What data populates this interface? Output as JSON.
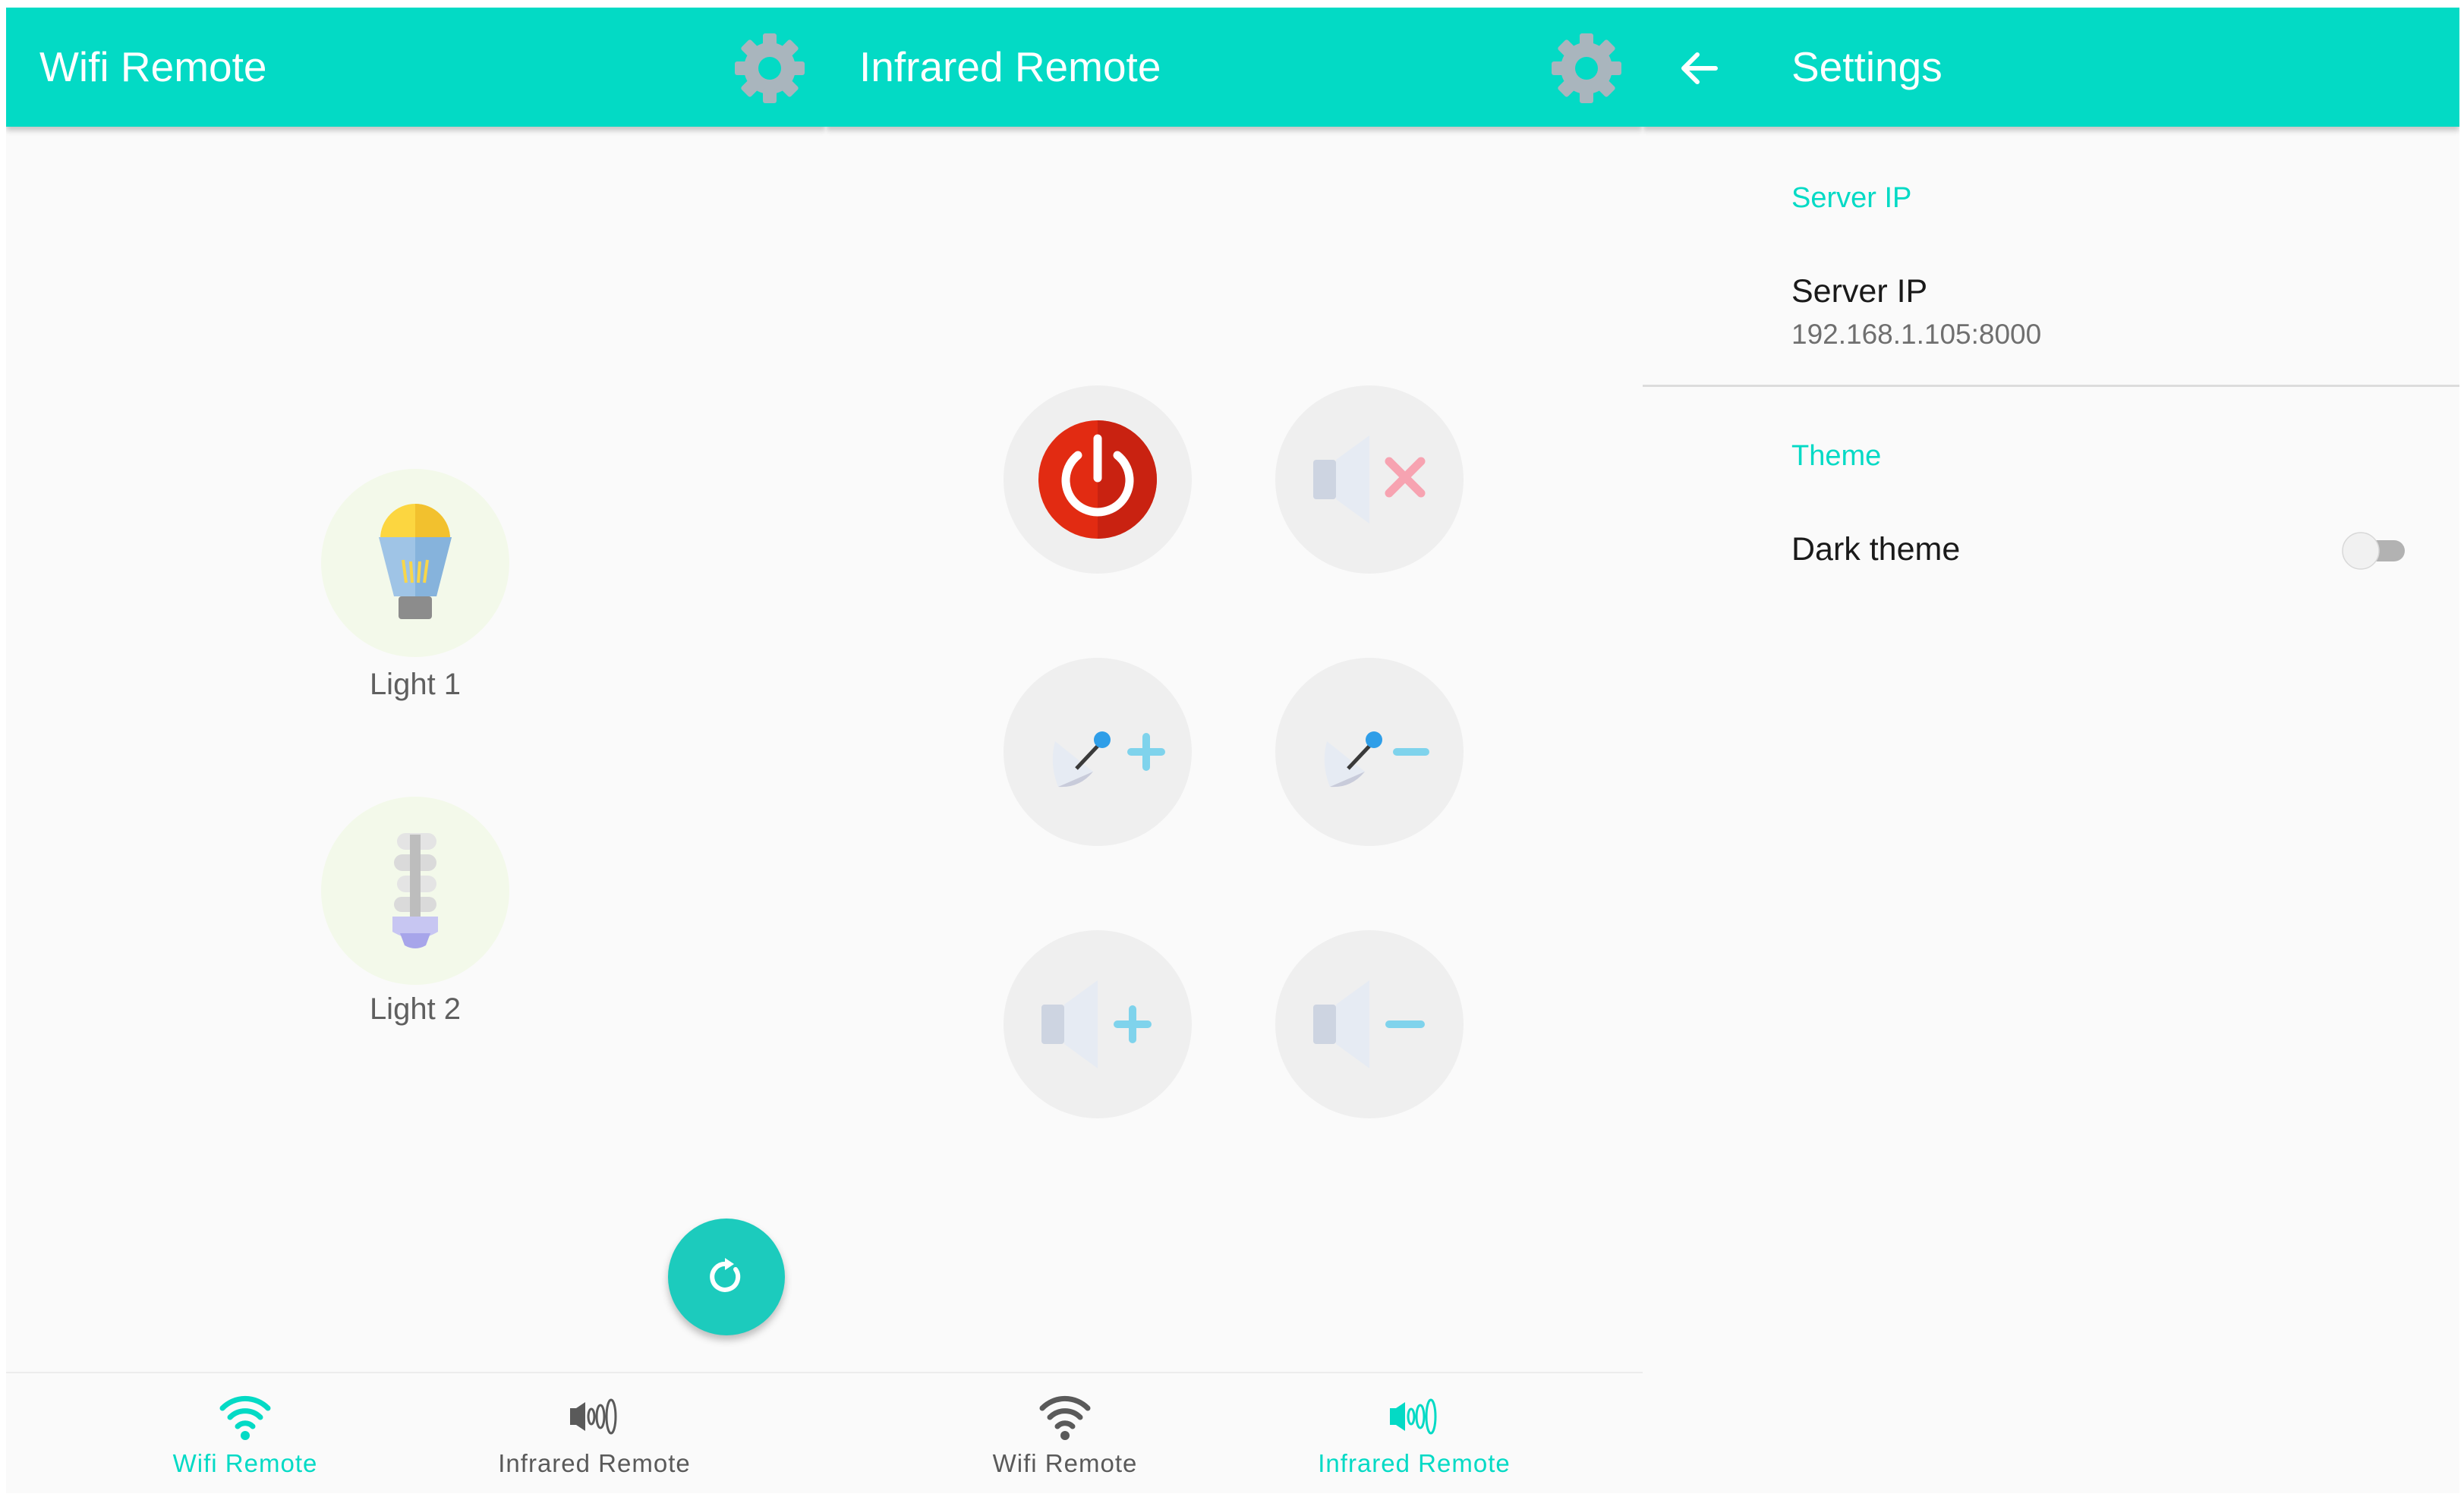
{
  "wifi_screen": {
    "title": "Wifi Remote",
    "settings_icon": "gear-icon",
    "lights": [
      {
        "label": "Light 1",
        "icon": "bulb-on-icon"
      },
      {
        "label": "Light 2",
        "icon": "bulb-off-icon"
      }
    ],
    "refresh_icon": "refresh-icon"
  },
  "infrared_screen": {
    "title": "Infrared Remote",
    "settings_icon": "gear-icon",
    "buttons": [
      "power-icon",
      "mute-icon",
      "channel-up-icon",
      "channel-down-icon",
      "volume-up-icon",
      "volume-down-icon"
    ]
  },
  "bottom_nav": {
    "items": [
      {
        "label": "Wifi Remote",
        "icon": "wifi-icon"
      },
      {
        "label": "Infrared Remote",
        "icon": "infrared-icon"
      }
    ]
  },
  "settings_screen": {
    "title": "Settings",
    "server_category": "Server IP",
    "server_ip_title": "Server IP",
    "server_ip_value": "192.168.1.105:8000",
    "theme_category": "Theme",
    "dark_theme_label": "Dark theme",
    "dark_theme_enabled": false
  },
  "colors": {
    "accent": "#03dac5",
    "fab": "#1ccbbd",
    "inactive_nav": "#5a5a5a",
    "power_red": "#e22b12"
  }
}
